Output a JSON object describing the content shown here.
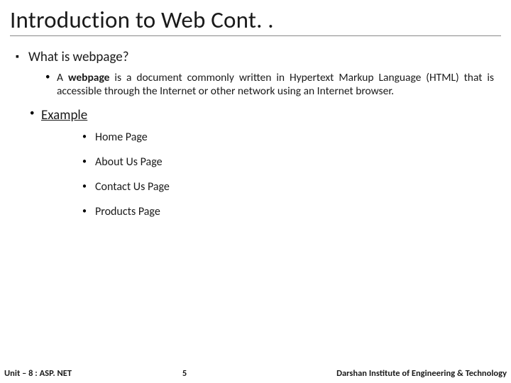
{
  "title": "Introduction to Web Cont. .",
  "bullets": {
    "q": "What is webpage?",
    "def_prefix": "A ",
    "def_term": "webpage",
    "def_rest": " is a document commonly written in Hypertext Markup Language (HTML) that is accessible through the Internet or other network using an Internet browser.",
    "example_label": "Example",
    "examples": {
      "e0": "Home Page",
      "e1": "About Us Page",
      "e2": "Contact Us Page",
      "e3": "Products Page"
    }
  },
  "footer": {
    "left": "Unit – 8 : ASP. NET",
    "page": "5",
    "right": "Darshan Institute of Engineering & Technology"
  }
}
